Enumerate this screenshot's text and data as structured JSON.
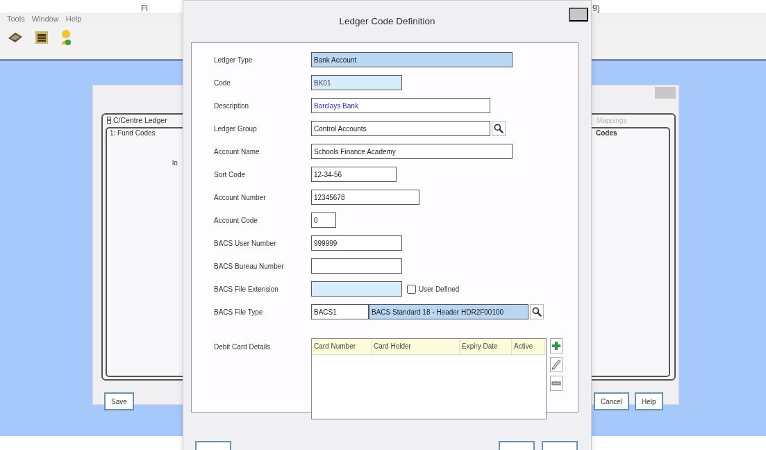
{
  "app": {
    "title_fragments": [
      "Fl",
      "9)"
    ],
    "menu": [
      {
        "label": "Tools"
      },
      {
        "label": "Window"
      },
      {
        "label": "Help"
      }
    ]
  },
  "background_window": {
    "tab": "C/Centre Ledger",
    "tab_right": "Mappings",
    "subtab": "1: Fund Codes",
    "subtab_right": "Codes",
    "fragment": "lo",
    "buttons": [
      "Save",
      "Cancel",
      "Help"
    ]
  },
  "dialog": {
    "title": "Ledger Code Definition",
    "fields": [
      {
        "label": "Ledger Type",
        "kind": "dropdown",
        "value": "Bank Account"
      },
      {
        "label": "Code",
        "kind": "readonly",
        "value": "BK01"
      },
      {
        "label": "Description",
        "kind": "link-text",
        "value": "Barclays Bank"
      },
      {
        "label": "Ledger Group",
        "kind": "lookup",
        "value": "Control Accounts"
      },
      {
        "label": "Account Name",
        "kind": "text",
        "value": "Schools Finance Academy"
      },
      {
        "label": "Sort Code",
        "kind": "text",
        "value": "12-34-56"
      },
      {
        "label": "Account Number",
        "kind": "text",
        "value": "12345678"
      },
      {
        "label": "Account Code",
        "kind": "text",
        "value": "0"
      },
      {
        "label": "BACS User Number",
        "kind": "text",
        "value": "999999"
      },
      {
        "label": "BACS Bureau Number",
        "kind": "text"
      },
      {
        "label": "BACS File Extension",
        "kind": "checkbox-field",
        "checkbox": {
          "label": "User Defined",
          "checked": false
        }
      },
      {
        "label": "BACS File Type",
        "kind": "code-lookup",
        "value": "BACS1",
        "description": "BACS Standard 18 - Header HDR2F00100"
      }
    ],
    "debit_cards": {
      "label": "Debit Card Details",
      "columns": [
        "Card Number",
        "Card Holder",
        "Expiry Date",
        "Active"
      ]
    }
  }
}
